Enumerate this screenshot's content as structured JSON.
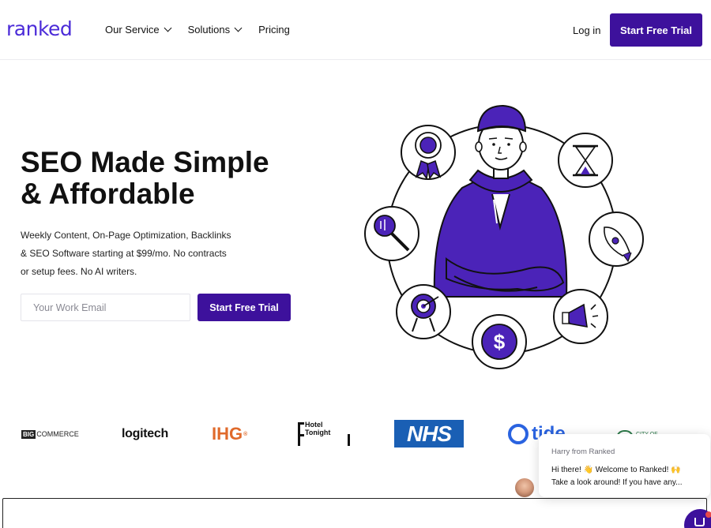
{
  "header": {
    "logo": "ranked",
    "nav": [
      {
        "label": "Our Service",
        "dropdown": true
      },
      {
        "label": "Solutions",
        "dropdown": true
      },
      {
        "label": "Pricing",
        "dropdown": false
      }
    ],
    "login_label": "Log in",
    "cta_label": "Start Free Trial"
  },
  "hero": {
    "title_line1": "SEO Made Simple",
    "title_line2": "& Affordable",
    "subtitle_line1": "Weekly Content, On-Page Optimization, Backlinks",
    "subtitle_line2": "& SEO Software starting at $99/mo. No contracts",
    "subtitle_line3": "or setup fees. No AI writers.",
    "email_placeholder": "Your Work Email",
    "cta_label": "Start Free Trial",
    "illustration_icons": [
      "medal-icon",
      "hourglass-icon",
      "magnifier-icon",
      "rocket-icon",
      "target-icon",
      "dollar-icon",
      "megaphone-icon"
    ]
  },
  "logos": {
    "bigcommerce": {
      "prefix": "BIG",
      "rest": "COMMERCE"
    },
    "logitech": "logitech",
    "ihg": "IHG",
    "ihg_mark": "®",
    "hotel_tonight": "Hotel Tonight",
    "nhs": "NHS",
    "tide": "tide",
    "city": "CITY OF"
  },
  "chat": {
    "from": "Harry from Ranked",
    "message_line1": "Hi there! 👋 Welcome to Ranked! 🙌",
    "message_line2": "Take a look around! If you have any..."
  },
  "colors": {
    "brand": "#3d119c",
    "logo": "#4b2bd8",
    "ihg": "#e06a2b",
    "nhs": "#1a5fb4",
    "tide": "#2a63e0"
  }
}
